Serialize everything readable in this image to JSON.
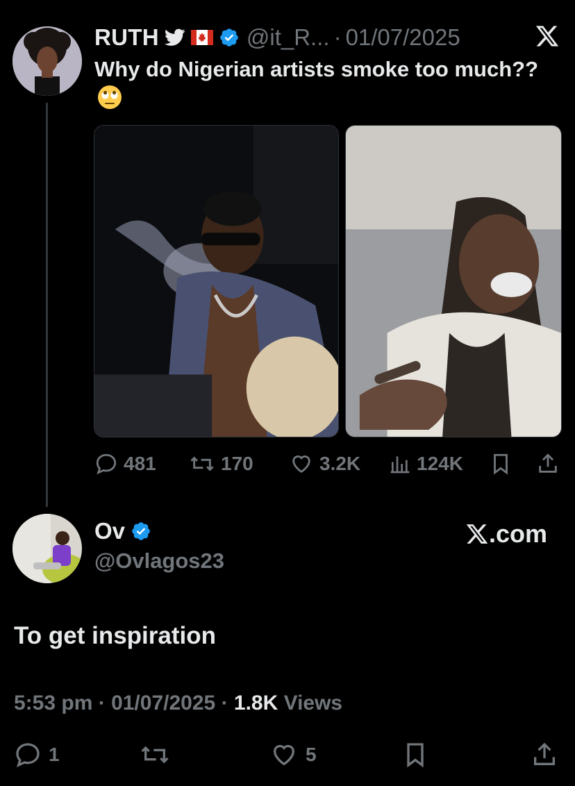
{
  "original_tweet": {
    "author_name": "RUTH",
    "handle": "@it_R...",
    "separator": "·",
    "date": "01/07/2025",
    "text": "Why do Nigerian artists smoke too much??",
    "emoji": "eye-roll-emoji",
    "flag_icon": "canada-flag-icon",
    "bird_icon": "twitter-bird-icon",
    "media": [
      {
        "description_icon": "photo-man-sunglasses-smoking"
      },
      {
        "description_icon": "photo-man-dreadlocks-smoking"
      }
    ],
    "stats": {
      "replies": "481",
      "reposts": "170",
      "likes": "3.2K",
      "views": "124K"
    }
  },
  "reply_tweet": {
    "author_name": "Ov",
    "handle": "@Ovlagos23",
    "source": ".com",
    "text": "To get inspiration",
    "time": "5:53 pm",
    "date": "01/07/2025",
    "views_count": "1.8K",
    "views_label": "Views",
    "stats": {
      "replies": "1",
      "likes": "5"
    }
  },
  "colors": {
    "background": "#000000",
    "text_primary": "#e7e9ea",
    "text_muted": "#71767b",
    "verified": "#1d9bf0",
    "divider": "#333639"
  }
}
